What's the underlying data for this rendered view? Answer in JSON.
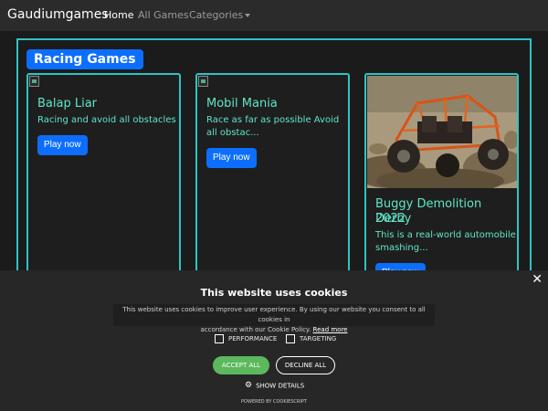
{
  "nav": {
    "brand": "Gaudiumgames",
    "links": [
      "Home",
      "All Games",
      "Categories"
    ]
  },
  "section": {
    "title": "Racing Games"
  },
  "cards": [
    {
      "title": "Balap Liar",
      "text": "Racing and avoid all obstacles",
      "button": "Play now"
    },
    {
      "title": "Mobil Mania",
      "text_line1": "Race as far as possible Avoid",
      "text_line2": "all obstac...",
      "button": "Play now"
    },
    {
      "title_line1": "Buggy Demolition Derby",
      "title_line2": "2022",
      "text_line1": "This is a real-world automobile",
      "text_line2": "smashing...",
      "button": "Play now"
    }
  ],
  "cookie": {
    "title": "This website uses cookies",
    "text_line1": "This website uses cookies to improve user experience. By using our website you consent to all cookies in",
    "text_line2": "accordance with our Cookie Policy.",
    "read_more": "Read more",
    "checkbox_performance": "PERFORMANCE",
    "checkbox_targeting": "TARGETING",
    "accept": "ACCEPT ALL",
    "decline": "DECLINE ALL",
    "details": "SHOW DETAILS",
    "powered": "POWERED BY COOKIESCRIPT",
    "close": "✕"
  },
  "colors": {
    "accent": "#0d6efd",
    "border": "#2ec4c4",
    "text_teal": "#5fe6c8",
    "accept": "#5cb85c"
  },
  "icons": [
    "broken-image-icon",
    "gear-icon",
    "close-icon",
    "caret-down-icon"
  ]
}
